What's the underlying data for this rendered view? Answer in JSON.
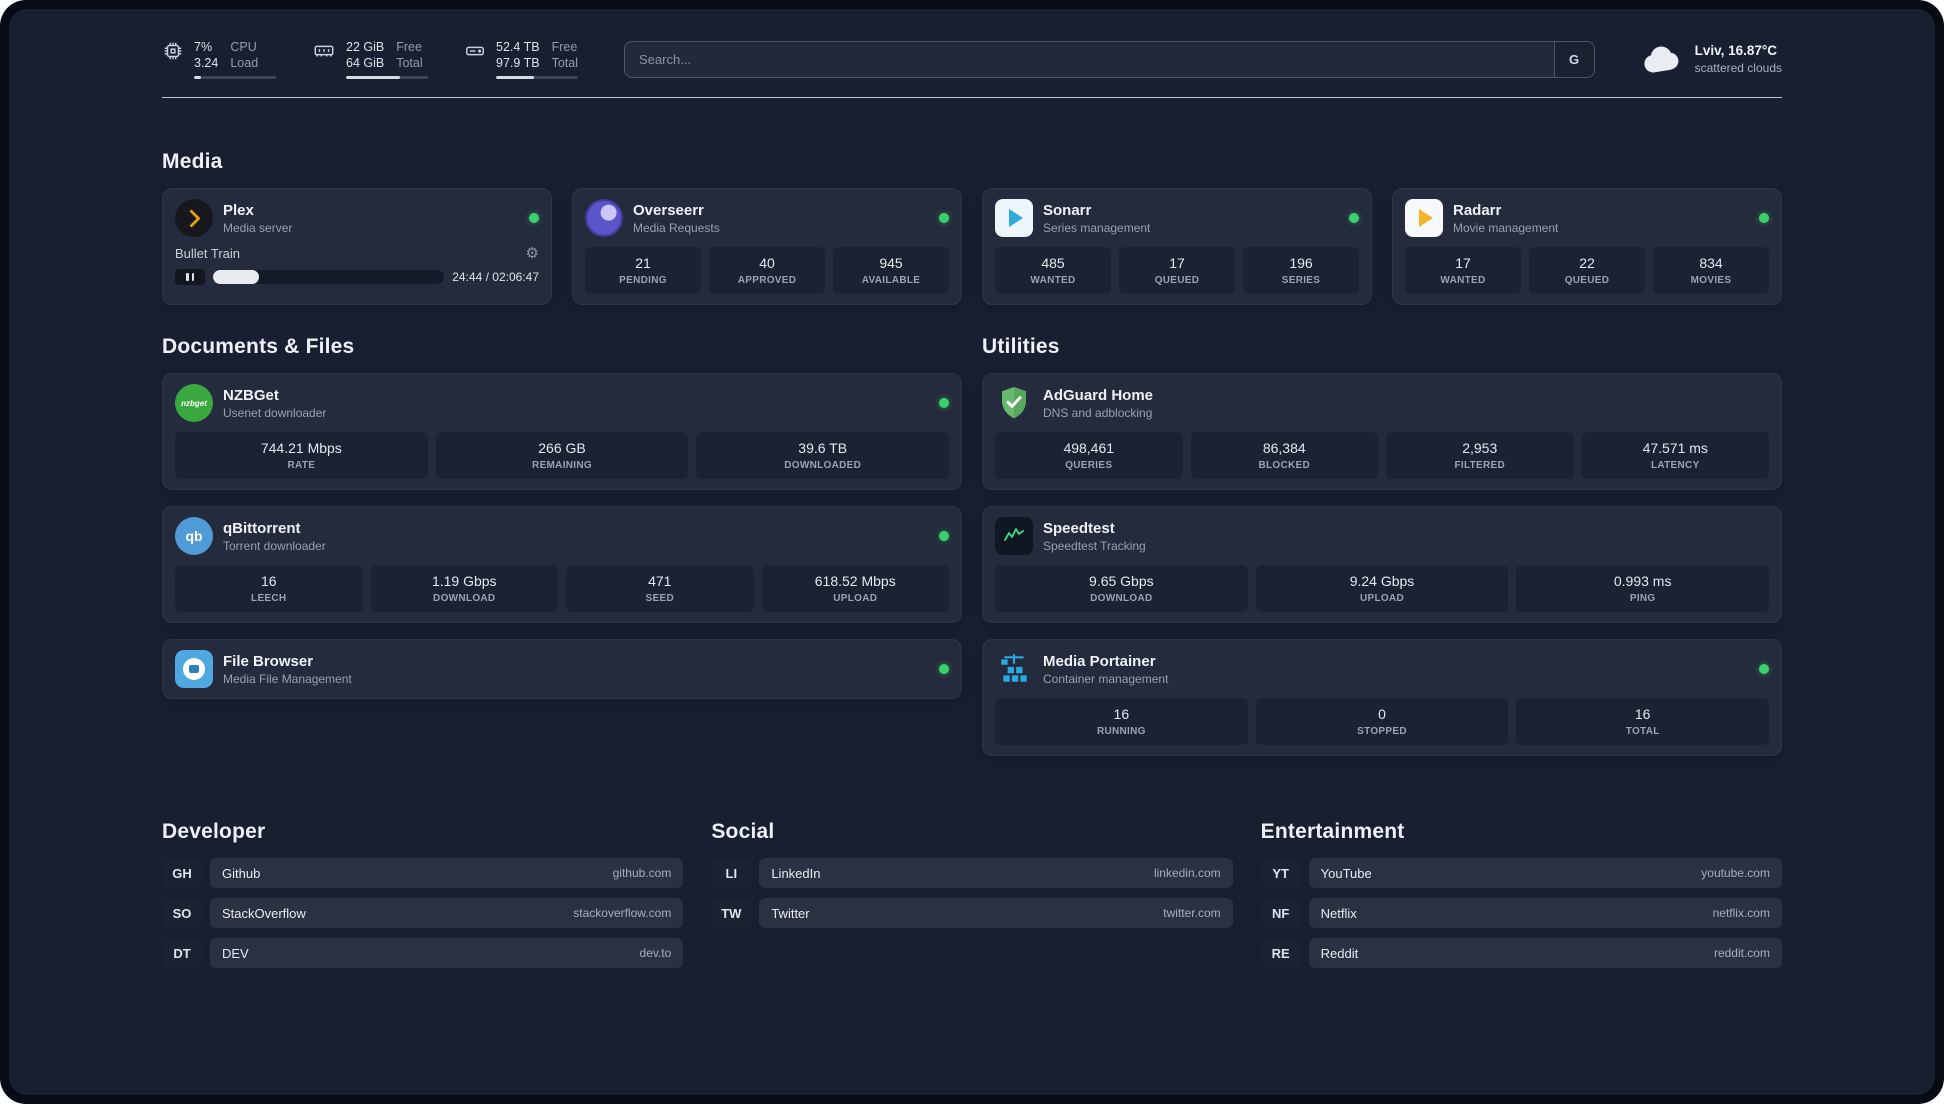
{
  "topbar": {
    "resources": [
      {
        "icon": "cpu-icon",
        "primary": "7%",
        "secondary": "3.24",
        "label_top": "CPU",
        "label_bottom": "Load",
        "percent": 8
      },
      {
        "icon": "memory-icon",
        "primary": "22 GiB",
        "secondary": "64 GiB",
        "label_top": "Free",
        "label_bottom": "Total",
        "percent": 66
      },
      {
        "icon": "disk-icon",
        "primary": "52.4 TB",
        "secondary": "97.9 TB",
        "label_top": "Free",
        "label_bottom": "Total",
        "percent": 46
      }
    ],
    "search": {
      "placeholder": "Search...",
      "provider_button": "G"
    },
    "weather": {
      "icon": "cloud-icon",
      "location": "Lviv, 16.87°C",
      "description": "scattered clouds"
    }
  },
  "colors": {
    "status_online": "#3bd06c",
    "accent_green": "#3ddc84",
    "panel_bg": "#181f30",
    "card_bg": "#242b3c"
  },
  "media": {
    "title": "Media",
    "services": [
      {
        "icon": "plex-icon",
        "name": "Plex",
        "desc": "Media server",
        "status": "online",
        "player": {
          "title": "Bullet Train",
          "time": "24:44 / 02:06:47",
          "progress_percent": 20
        }
      },
      {
        "icon": "overseerr-icon",
        "name": "Overseerr",
        "desc": "Media Requests",
        "status": "online",
        "stats": [
          {
            "value": "21",
            "label": "PENDING"
          },
          {
            "value": "40",
            "label": "APPROVED"
          },
          {
            "value": "945",
            "label": "AVAILABLE"
          }
        ]
      },
      {
        "icon": "sonarr-icon",
        "name": "Sonarr",
        "desc": "Series management",
        "status": "online",
        "stats": [
          {
            "value": "485",
            "label": "WANTED"
          },
          {
            "value": "17",
            "label": "QUEUED"
          },
          {
            "value": "196",
            "label": "SERIES"
          }
        ]
      },
      {
        "icon": "radarr-icon",
        "name": "Radarr",
        "desc": "Movie management",
        "status": "online",
        "stats": [
          {
            "value": "17",
            "label": "WANTED"
          },
          {
            "value": "22",
            "label": "QUEUED"
          },
          {
            "value": "834",
            "label": "MOVIES"
          }
        ]
      }
    ]
  },
  "documents": {
    "title": "Documents & Files",
    "services": [
      {
        "icon": "nzbget-icon",
        "name": "NZBGet",
        "desc": "Usenet downloader",
        "status": "online",
        "stats": [
          {
            "value": "744.21 Mbps",
            "label": "RATE"
          },
          {
            "value": "266 GB",
            "label": "REMAINING"
          },
          {
            "value": "39.6 TB",
            "label": "DOWNLOADED"
          }
        ]
      },
      {
        "icon": "qbittorrent-icon",
        "name": "qBittorrent",
        "desc": "Torrent downloader",
        "status": "online",
        "stats": [
          {
            "value": "16",
            "label": "LEECH"
          },
          {
            "value": "1.19 Gbps",
            "label": "DOWNLOAD"
          },
          {
            "value": "471",
            "label": "SEED"
          },
          {
            "value": "618.52 Mbps",
            "label": "UPLOAD"
          }
        ]
      },
      {
        "icon": "filebrowser-icon",
        "name": "File Browser",
        "desc": "Media File Management",
        "status": "online"
      }
    ]
  },
  "utilities": {
    "title": "Utilities",
    "services": [
      {
        "icon": "adguard-icon",
        "name": "AdGuard Home",
        "desc": "DNS and adblocking",
        "stats": [
          {
            "value": "498,461",
            "label": "QUERIES"
          },
          {
            "value": "86,384",
            "label": "BLOCKED"
          },
          {
            "value": "2,953",
            "label": "FILTERED"
          },
          {
            "value": "47.571 ms",
            "label": "LATENCY"
          }
        ]
      },
      {
        "icon": "speedtest-icon",
        "name": "Speedtest",
        "desc": "Speedtest Tracking",
        "stats": [
          {
            "value": "9.65 Gbps",
            "label": "DOWNLOAD"
          },
          {
            "value": "9.24 Gbps",
            "label": "UPLOAD"
          },
          {
            "value": "0.993 ms",
            "label": "PING"
          }
        ]
      },
      {
        "icon": "portainer-icon",
        "name": "Media Portainer",
        "desc": "Container management",
        "status": "online",
        "stats": [
          {
            "value": "16",
            "label": "RUNNING"
          },
          {
            "value": "0",
            "label": "STOPPED"
          },
          {
            "value": "16",
            "label": "TOTAL"
          }
        ]
      }
    ]
  },
  "bookmarks": {
    "groups": [
      {
        "title": "Developer",
        "items": [
          {
            "abbr": "GH",
            "name": "Github",
            "url": "github.com"
          },
          {
            "abbr": "SO",
            "name": "StackOverflow",
            "url": "stackoverflow.com"
          },
          {
            "abbr": "DT",
            "name": "DEV",
            "url": "dev.to"
          }
        ]
      },
      {
        "title": "Social",
        "items": [
          {
            "abbr": "LI",
            "name": "LinkedIn",
            "url": "linkedin.com"
          },
          {
            "abbr": "TW",
            "name": "Twitter",
            "url": "twitter.com"
          }
        ]
      },
      {
        "title": "Entertainment",
        "items": [
          {
            "abbr": "YT",
            "name": "YouTube",
            "url": "youtube.com"
          },
          {
            "abbr": "NF",
            "name": "Netflix",
            "url": "netflix.com"
          },
          {
            "abbr": "RE",
            "name": "Reddit",
            "url": "reddit.com"
          }
        ]
      }
    ]
  }
}
